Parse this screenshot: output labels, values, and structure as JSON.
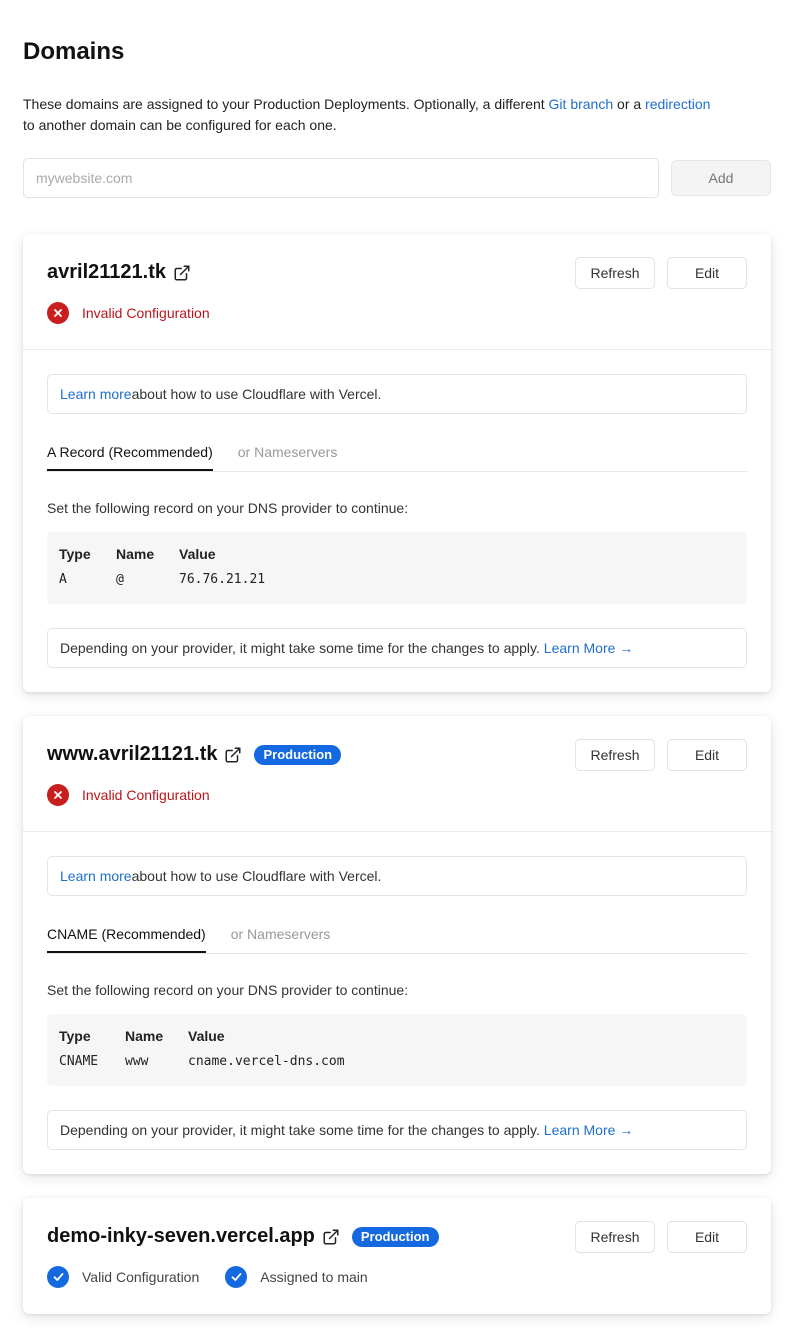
{
  "page": {
    "title": "Domains",
    "intro_text": "These domains are assigned to your Production Deployments. Optionally, a different ",
    "intro_link1": "Git branch",
    "intro_mid": " or a ",
    "intro_link2": "redirection",
    "intro_end": " to another domain can be configured for each one."
  },
  "add": {
    "placeholder": "mywebsite.com",
    "button_label": "Add"
  },
  "colors": {
    "link": "#1f6fd1",
    "production_badge": "#1469e0",
    "invalid": "#c81e1e",
    "valid": "#1469e0"
  },
  "domains": [
    {
      "name": "avril21121.tk",
      "badge": "",
      "refresh_label": "Refresh",
      "edit_label": "Edit",
      "status": "Invalid Configuration",
      "learn_link": "Learn more",
      "learn_text": " about how to use Cloudflare with Vercel.",
      "tab_active": "A Record (Recommended)",
      "tab_inactive": "or Nameservers",
      "instruction": "Set the following record on your DNS provider to continue:",
      "record": {
        "type_label": "Type",
        "name_label": "Name",
        "value_label": "Value",
        "type": "A",
        "name": "@",
        "value": "76.76.21.21"
      },
      "footer_text": "Depending on your provider, it might take some time for the changes to apply. ",
      "footer_link": "Learn More →"
    },
    {
      "name": "www.avril21121.tk",
      "badge": "Production",
      "refresh_label": "Refresh",
      "edit_label": "Edit",
      "status": "Invalid Configuration",
      "learn_link": "Learn more",
      "learn_text": " about how to use Cloudflare with Vercel.",
      "tab_active": "CNAME (Recommended)",
      "tab_inactive": "or Nameservers",
      "instruction": "Set the following record on your DNS provider to continue:",
      "record": {
        "type_label": "Type",
        "name_label": "Name",
        "value_label": "Value",
        "type": "CNAME",
        "name": "www",
        "value": "cname.vercel-dns.com"
      },
      "footer_text": "Depending on your provider, it might take some time for the changes to apply. ",
      "footer_link": "Learn More →"
    },
    {
      "name": "demo-inky-seven.vercel.app",
      "badge": "Production",
      "refresh_label": "Refresh",
      "edit_label": "Edit",
      "status_valid": "Valid Configuration",
      "status_assigned": "Assigned to main"
    }
  ]
}
